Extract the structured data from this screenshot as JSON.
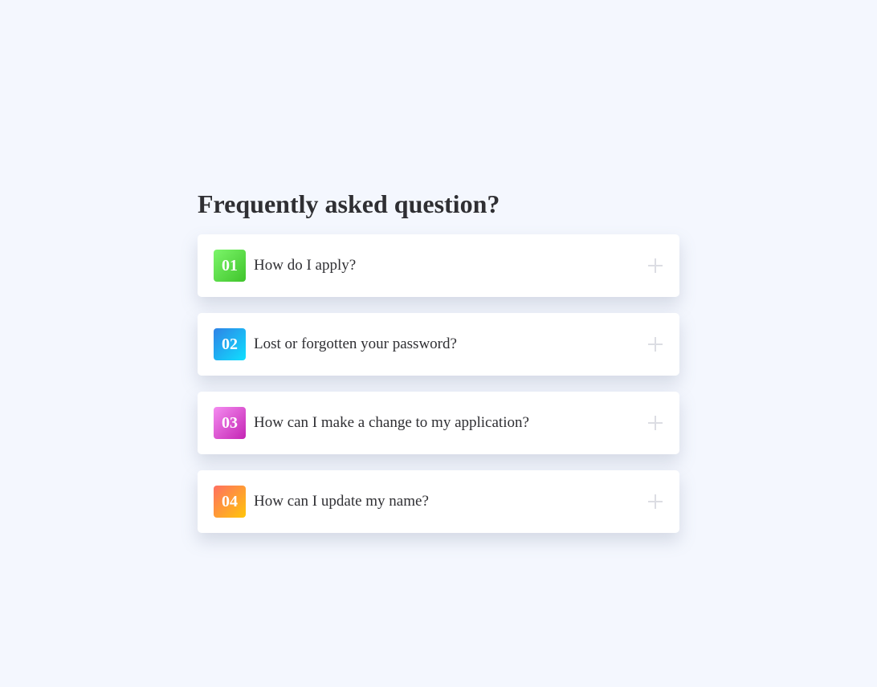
{
  "faq": {
    "title": "Frequently asked question?",
    "items": [
      {
        "number": "01",
        "question": "How do I apply?",
        "badge_colors": [
          "#7cf56a",
          "#3fc42b"
        ],
        "icon": "plus-icon"
      },
      {
        "number": "02",
        "question": "Lost or forgotten your password?",
        "badge_colors": [
          "#2f82e6",
          "#0fe0ff"
        ],
        "icon": "plus-icon"
      },
      {
        "number": "03",
        "question": "How can I make a change to my application?",
        "badge_colors": [
          "#f48cf0",
          "#c424b4"
        ],
        "icon": "plus-icon"
      },
      {
        "number": "04",
        "question": "How can I update my name?",
        "badge_colors": [
          "#ff6f61",
          "#ffc60a"
        ],
        "icon": "plus-icon"
      }
    ]
  },
  "colors": {
    "background": "#f4f7fe",
    "card": "#ffffff",
    "text": "#2f2f33",
    "icon": "#dcdde3"
  }
}
